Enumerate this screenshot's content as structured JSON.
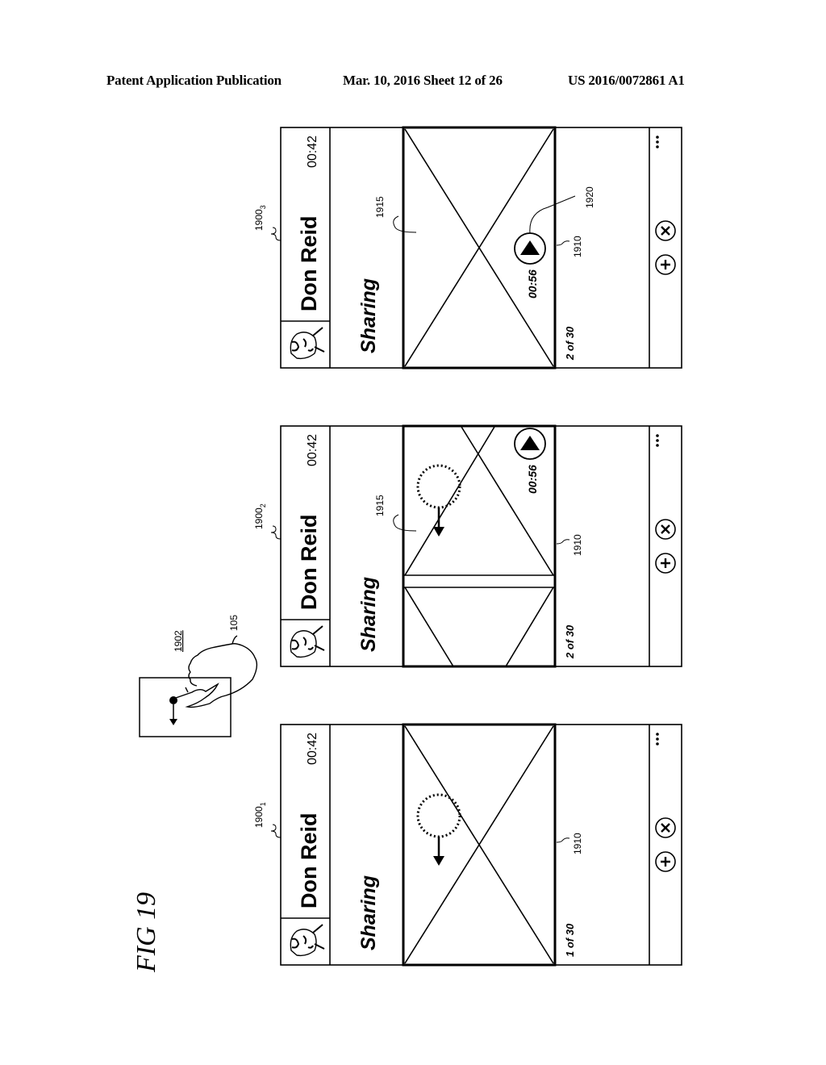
{
  "header": {
    "publication": "Patent Application Publication",
    "date_sheet": "Mar. 10, 2016  Sheet 12 of 26",
    "patent_number": "US 2016/0072861 A1"
  },
  "figure": {
    "label": "FIG 19",
    "gesture": {
      "ref_box": "1902",
      "ref_hand": "105",
      "direction": "down"
    },
    "panels": [
      {
        "ref_base": "1900",
        "ref_sub": "1",
        "contact_name": "Don Reid",
        "call_time": "00:42",
        "title": "Sharing",
        "counter": "1 of 30",
        "ref_footer": "1910",
        "icons": [
          "avatar-icon",
          "add-icon",
          "close-icon",
          "more-icon"
        ]
      },
      {
        "ref_base": "1900",
        "ref_sub": "2",
        "contact_name": "Don Reid",
        "call_time": "00:42",
        "title": "Sharing",
        "counter": "2 of 30",
        "duration": "00:56",
        "ref_footer": "1910",
        "ref_image": "1915",
        "icons": [
          "avatar-icon",
          "play-icon",
          "add-icon",
          "close-icon",
          "more-icon"
        ]
      },
      {
        "ref_base": "1900",
        "ref_sub": "3",
        "contact_name": "Don Reid",
        "call_time": "00:42",
        "title": "Sharing",
        "counter": "2 of 30",
        "duration": "00:56",
        "ref_footer": "1910",
        "ref_image": "1915",
        "ref_play": "1920",
        "icons": [
          "avatar-icon",
          "play-icon",
          "add-icon",
          "close-icon",
          "more-icon"
        ]
      }
    ]
  },
  "colors": {
    "ink": "#000000",
    "paper": "#ffffff"
  }
}
